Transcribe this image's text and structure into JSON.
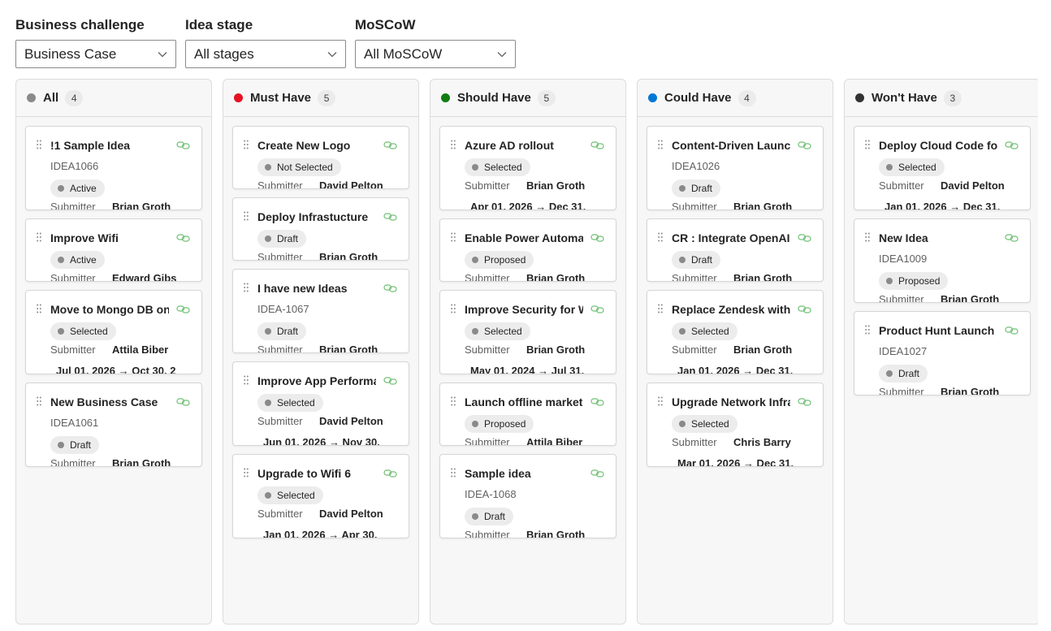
{
  "filters": {
    "business_challenge": {
      "label": "Business challenge",
      "value": "Business Case"
    },
    "idea_stage": {
      "label": "Idea stage",
      "value": "All stages"
    },
    "moscow": {
      "label": "MoSCoW",
      "value": "All MoSCoW"
    }
  },
  "board": {
    "submitter_label": "Submitter",
    "columns": [
      {
        "title": "All",
        "count": "4",
        "color": "#8a8a8a",
        "cards": [
          {
            "title": "!1 Sample Idea",
            "id": "IDEA1066",
            "status": "Active",
            "submitter": "Brian Groth",
            "dates": ""
          },
          {
            "title": "Improve Wifi",
            "id": "",
            "status": "Active",
            "submitter": "Edward Gibs",
            "dates": ""
          },
          {
            "title": "Move to Mongo DB on",
            "id": "",
            "status": "Selected",
            "submitter": "Attila Biber",
            "dates": "Jul 01, 2026 → Oct 30, 2"
          },
          {
            "title": "New Business Case",
            "id": "IDEA1061",
            "status": "Draft",
            "submitter": "Brian Groth",
            "dates": ""
          }
        ]
      },
      {
        "title": "Must Have",
        "count": "5",
        "color": "#e81123",
        "cards": [
          {
            "title": "Create New Logo",
            "id": "",
            "status": "Not Selected",
            "submitter": "David Pelton",
            "dates": ""
          },
          {
            "title": "Deploy Infrastucture",
            "id": "",
            "status": "Draft",
            "submitter": "Brian Groth",
            "dates": ""
          },
          {
            "title": "I have new Ideas",
            "id": "IDEA-1067",
            "status": "Draft",
            "submitter": "Brian Groth",
            "dates": ""
          },
          {
            "title": "Improve App Performa",
            "id": "",
            "status": "Selected",
            "submitter": "David Pelton",
            "dates": "Jun 01, 2026 → Nov 30,"
          },
          {
            "title": "Upgrade to Wifi 6",
            "id": "",
            "status": "Selected",
            "submitter": "David Pelton",
            "dates": "Jan 01, 2026 → Apr 30,"
          }
        ]
      },
      {
        "title": "Should Have",
        "count": "5",
        "color": "#107c10",
        "cards": [
          {
            "title": "Azure AD rollout",
            "id": "",
            "status": "Selected",
            "submitter": "Brian Groth",
            "dates": "Apr 01, 2026 → Dec 31,"
          },
          {
            "title": "Enable Power Automate",
            "id": "",
            "status": "Proposed",
            "submitter": "Brian Groth",
            "dates": ""
          },
          {
            "title": "Improve Security for W",
            "id": "",
            "status": "Selected",
            "submitter": "Brian Groth",
            "dates": "May 01, 2024 → Jul 31,"
          },
          {
            "title": "Launch offline marketing",
            "id": "",
            "status": "Proposed",
            "submitter": "Attila Biber",
            "dates": ""
          },
          {
            "title": "Sample idea",
            "id": "IDEA-1068",
            "status": "Draft",
            "submitter": "Brian Groth",
            "dates": ""
          }
        ]
      },
      {
        "title": "Could Have",
        "count": "4",
        "color": "#0078d4",
        "cards": [
          {
            "title": "Content-Driven Launch",
            "id": "IDEA1026",
            "status": "Draft",
            "submitter": "Brian Groth",
            "dates": ""
          },
          {
            "title": "CR : Integrate OpenAI",
            "id": "",
            "status": "Draft",
            "submitter": "Brian Groth",
            "dates": ""
          },
          {
            "title": "Replace Zendesk with",
            "id": "",
            "status": "Selected",
            "submitter": "Brian Groth",
            "dates": "Jan 01, 2026 → Dec 31,"
          },
          {
            "title": "Upgrade Network Infra",
            "id": "",
            "status": "Selected",
            "submitter": "Chris Barry",
            "dates": "Mar 01, 2026 → Dec 31,"
          }
        ]
      },
      {
        "title": "Won't Have",
        "count": "3",
        "color": "#323232",
        "cards": [
          {
            "title": "Deploy Cloud Code for",
            "id": "",
            "status": "Selected",
            "submitter": "David Pelton",
            "dates": "Jan 01, 2026 → Dec 31,"
          },
          {
            "title": "New Idea",
            "id": "IDEA1009",
            "status": "Proposed",
            "submitter": "Brian Groth",
            "dates": ""
          },
          {
            "title": "Product Hunt Launch",
            "id": "IDEA1027",
            "status": "Draft",
            "submitter": "Brian Groth",
            "dates": ""
          }
        ]
      }
    ]
  }
}
